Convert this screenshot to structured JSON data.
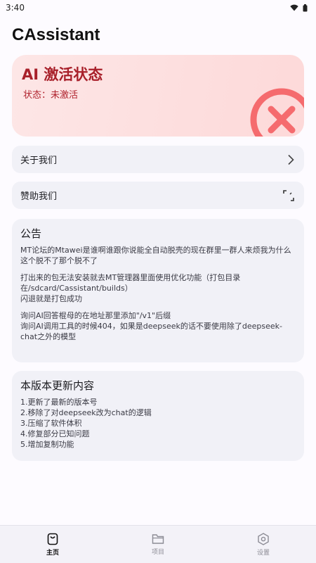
{
  "status_bar": {
    "time": "3:40"
  },
  "app": {
    "title": "CAssistant"
  },
  "activation": {
    "title": "AI 激活状态",
    "status": "状态：未激活"
  },
  "rows": {
    "about": "关于我们",
    "sponsor": "赞助我们"
  },
  "notice": {
    "title": "公告",
    "paragraphs": [
      "MT论坛的Mtawei是谁啊谁跟你说能全自动脱壳的现在群里一群人来烦我为什么这个脱不了那个脱不了",
      "打出来的包无法安装就去MT管理器里面使用优化功能（打包目录在/sdcard/Cassistant/builds）\n闪退就是打包成功",
      "询问AI回答棍母的在地址那里添加\"/v1\"后缀\n询问AI调用工具的时候404，如果是deepseek的话不要使用除了deepseek-chat之外的模型"
    ]
  },
  "update": {
    "title": "本版本更新内容",
    "items": [
      "1.更新了最新的版本号",
      "2.移除了对deepseek改为chat的逻辑",
      "3.压缩了软件体积",
      "4.修复部分已知问题",
      "5.增加复制功能"
    ]
  },
  "nav": {
    "home": "主页",
    "projects": "项目",
    "settings": "设置"
  },
  "colors": {
    "accent_red": "#a8202a",
    "x_icon_red": "#f56b6e",
    "card_bg": "#f1f1f7"
  },
  "icons": {
    "wifi": "wifi-icon",
    "battery": "battery-icon",
    "inactive": "x-circle-icon",
    "chevron": "chevron-right-icon",
    "sponsor": "expand-corners-icon",
    "home": "bag-icon",
    "projects": "folder-icon",
    "settings": "hexagon-settings-icon"
  }
}
